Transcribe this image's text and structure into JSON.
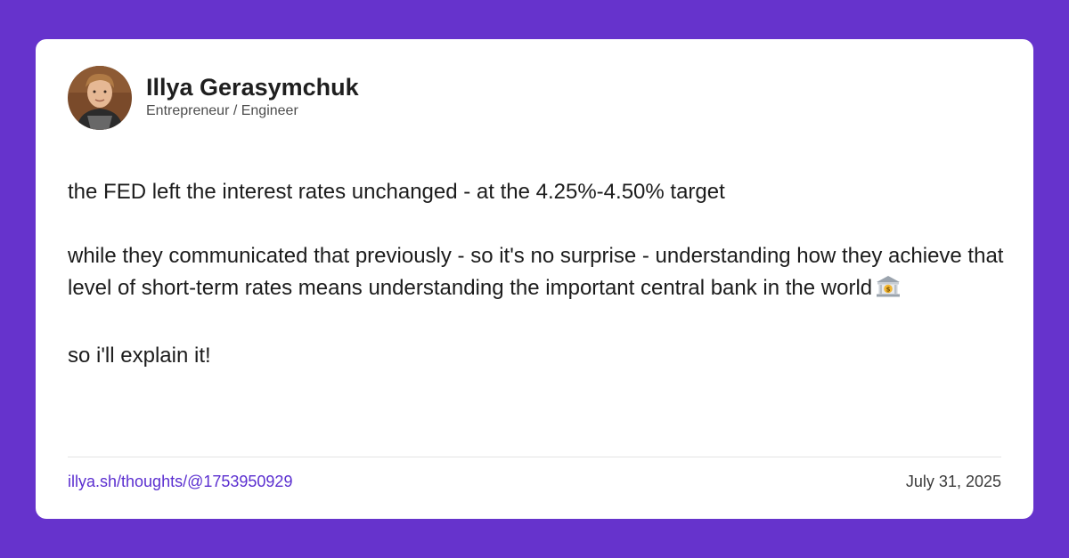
{
  "author": {
    "name": "Illya Gerasymchuk",
    "role": "Entrepreneur / Engineer"
  },
  "post": {
    "paragraph_1": "the FED left the interest rates unchanged - at the 4.25%-4.50% target",
    "paragraph_2": "while they communicated that previously - so it's no surprise - understanding how they achieve that level of short-term rates means understanding the important central bank in the world",
    "paragraph_2_icon": "bank-icon",
    "paragraph_3": "so i'll explain it!"
  },
  "footer": {
    "link": "illya.sh/thoughts/@1753950929",
    "date": "July 31, 2025"
  },
  "colors": {
    "background": "#6633cc",
    "card": "#ffffff",
    "link": "#5b2fd0",
    "text": "#1c1c1c"
  }
}
